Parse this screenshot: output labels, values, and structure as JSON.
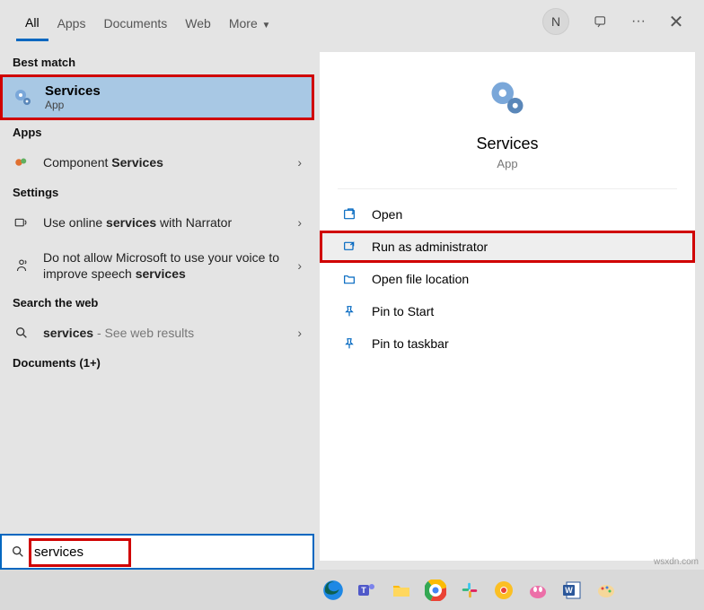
{
  "tabs": {
    "all": "All",
    "apps": "Apps",
    "documents": "Documents",
    "web": "Web",
    "more": "More"
  },
  "avatar": "N",
  "sections": {
    "best": "Best match",
    "apps": "Apps",
    "settings": "Settings",
    "web": "Search the web",
    "docs": "Documents (1+)"
  },
  "bestMatch": {
    "title": "Services",
    "sub": "App"
  },
  "appRow": {
    "pre": "Component ",
    "bold": "Services"
  },
  "setting1": {
    "pre": "Use online ",
    "bold": "services",
    "post": " with Narrator"
  },
  "setting2": {
    "pre": "Do not allow Microsoft to use your voice to improve speech ",
    "bold": "services"
  },
  "webRow": {
    "bold": "services",
    "post": " - See web results"
  },
  "detail": {
    "title": "Services",
    "sub": "App"
  },
  "actions": {
    "open": "Open",
    "admin": "Run as administrator",
    "loc": "Open file location",
    "pinStart": "Pin to Start",
    "pinTask": "Pin to taskbar"
  },
  "search": {
    "value": "services"
  },
  "watermark": "wsxdn.com"
}
